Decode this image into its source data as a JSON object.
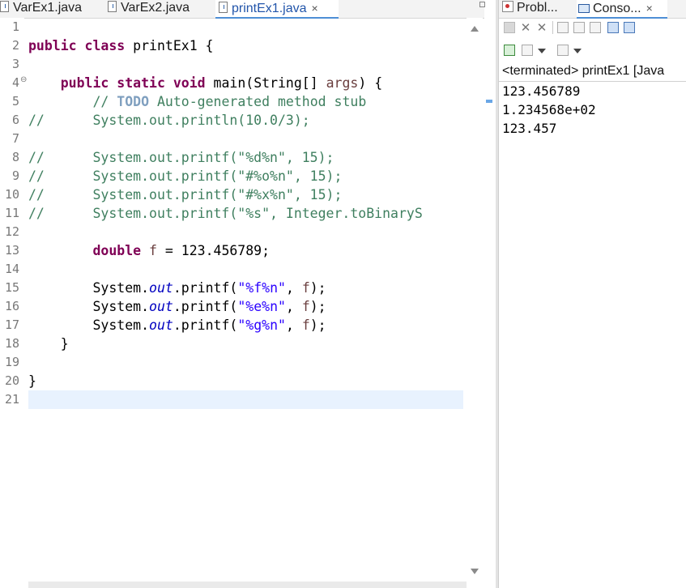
{
  "editor": {
    "tabs": [
      {
        "label": "VarEx1.java",
        "active": false
      },
      {
        "label": "VarEx2.java",
        "active": false
      },
      {
        "label": "printEx1.java",
        "active": true
      }
    ],
    "close_glyph": "×",
    "line_numbers": [
      "1",
      "2",
      "3",
      "4",
      "5",
      "6",
      "7",
      "8",
      "9",
      "10",
      "11",
      "12",
      "13",
      "14",
      "15",
      "16",
      "17",
      "18",
      "19",
      "20",
      "21"
    ],
    "fold_marker": "⊖",
    "code": {
      "l2": {
        "kw1": "public",
        "kw2": "class",
        "rest": " printEx1 {"
      },
      "l4": {
        "kw1": "public",
        "kw2": "static",
        "kw3": "void",
        "mid": " main(String[] ",
        "param": "args",
        "end": ") {"
      },
      "l5": {
        "pre": "// ",
        "todo": "TODO",
        "post": " Auto-generated method stub"
      },
      "l6": "//      System.out.println(10.0/3);",
      "l8": "//      System.out.printf(\"%d%n\", 15);",
      "l9": "//      System.out.printf(\"#%o%n\", 15);",
      "l10": "//      System.out.printf(\"#%x%n\", 15);",
      "l11": "//      System.out.printf(\"%s\", Integer.toBinaryS",
      "l13": {
        "kw": "double",
        "var": "f",
        "eq": " = 123.456789;"
      },
      "l15": {
        "sys": "System.",
        "out": "out",
        "m": ".printf(",
        "str": "\"%f%n\"",
        "sep": ", ",
        "arg": "f",
        "end": ");"
      },
      "l16": {
        "sys": "System.",
        "out": "out",
        "m": ".printf(",
        "str": "\"%e%n\"",
        "sep": ", ",
        "arg": "f",
        "end": ");"
      },
      "l17": {
        "sys": "System.",
        "out": "out",
        "m": ".printf(",
        "str": "\"%g%n\"",
        "sep": ", ",
        "arg": "f",
        "end": ");"
      },
      "l18": "}",
      "l20": "}"
    }
  },
  "console": {
    "tabs": [
      {
        "label": "Probl...",
        "icon": "problems-icon"
      },
      {
        "label": "Conso...",
        "icon": "console-icon",
        "active": true
      }
    ],
    "close_glyph": "×",
    "status": "<terminated> printEx1 [Java",
    "output": [
      "123.456789",
      "1.234568e+02",
      "123.457"
    ]
  },
  "colors": {
    "keyword": "#7f0055",
    "comment": "#3f7f5f",
    "string": "#2a00ff",
    "static_field": "#0000c0",
    "current_line": "#e8f2fe",
    "active_tab_border": "#4d8fd6"
  }
}
